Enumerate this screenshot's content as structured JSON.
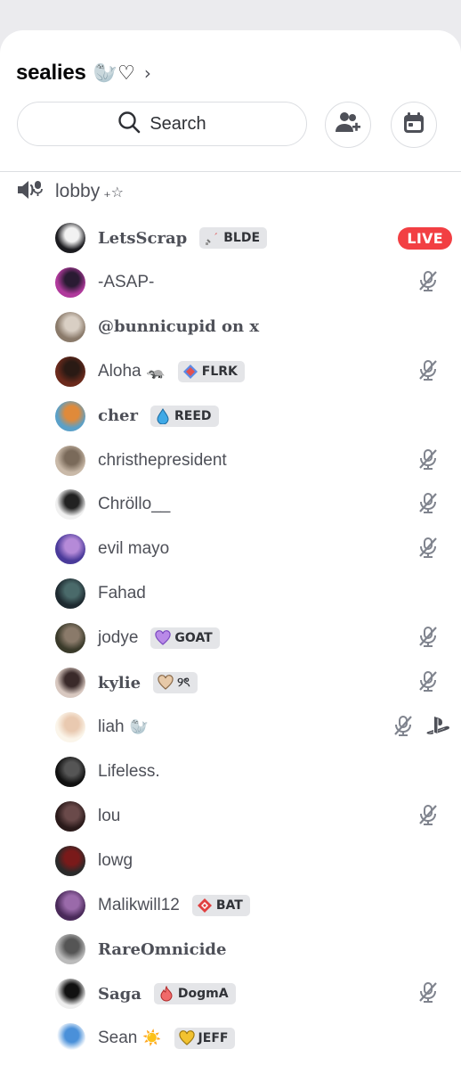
{
  "server": {
    "name": "sealies",
    "name_suffix": "🦭♡",
    "chevron": "›"
  },
  "search": {
    "label": "Search",
    "icon": "search-icon"
  },
  "actions": {
    "invite_icon": "add-member-icon",
    "events_icon": "calendar-icon"
  },
  "channel": {
    "name": "lobby",
    "decoration": "₊☆",
    "icon": "voice-channel-icon"
  },
  "members": [
    {
      "name": "LetsScrap",
      "tag": "BLDE",
      "tag_icon": "sword",
      "live": "LIVE"
    },
    {
      "name": "-ASAP-",
      "muted": true
    },
    {
      "name": "@bunnicupid on x"
    },
    {
      "name": "Aloha",
      "emoji": "🦡",
      "tag": "FLRK",
      "tag_icon": "diamond",
      "muted": true
    },
    {
      "name": "cher",
      "tag": "REED",
      "tag_icon": "drop"
    },
    {
      "name": "christhepresident",
      "muted": true
    },
    {
      "name": "Chröllo__",
      "muted": true
    },
    {
      "name": "evil mayo",
      "muted": true
    },
    {
      "name": "Fahad"
    },
    {
      "name": "jodye",
      "tag": "GOAT",
      "tag_icon": "heart-purple",
      "muted": true
    },
    {
      "name": "kylie",
      "tag": "୨ৎ",
      "tag_icon": "heart-beige",
      "muted": true
    },
    {
      "name": "liah",
      "emoji": "🦭",
      "muted": true,
      "playstation": true
    },
    {
      "name": "Lifeless."
    },
    {
      "name": "lou",
      "muted": true
    },
    {
      "name": "lowg"
    },
    {
      "name": "Malikwill12",
      "tag": "BAT",
      "tag_icon": "diamond-red"
    },
    {
      "name": "RareOmnicide"
    },
    {
      "name": "Saga",
      "tag": "DogmA",
      "tag_icon": "flame",
      "muted": true
    },
    {
      "name": "Sean",
      "emoji": "☀️",
      "tag": "JEFF",
      "tag_icon": "heart-gold"
    }
  ],
  "colors": {
    "live": "#f23f43",
    "text": "#4e5058",
    "tag_bg": "#e4e5e8",
    "divider": "#dcdee2"
  }
}
